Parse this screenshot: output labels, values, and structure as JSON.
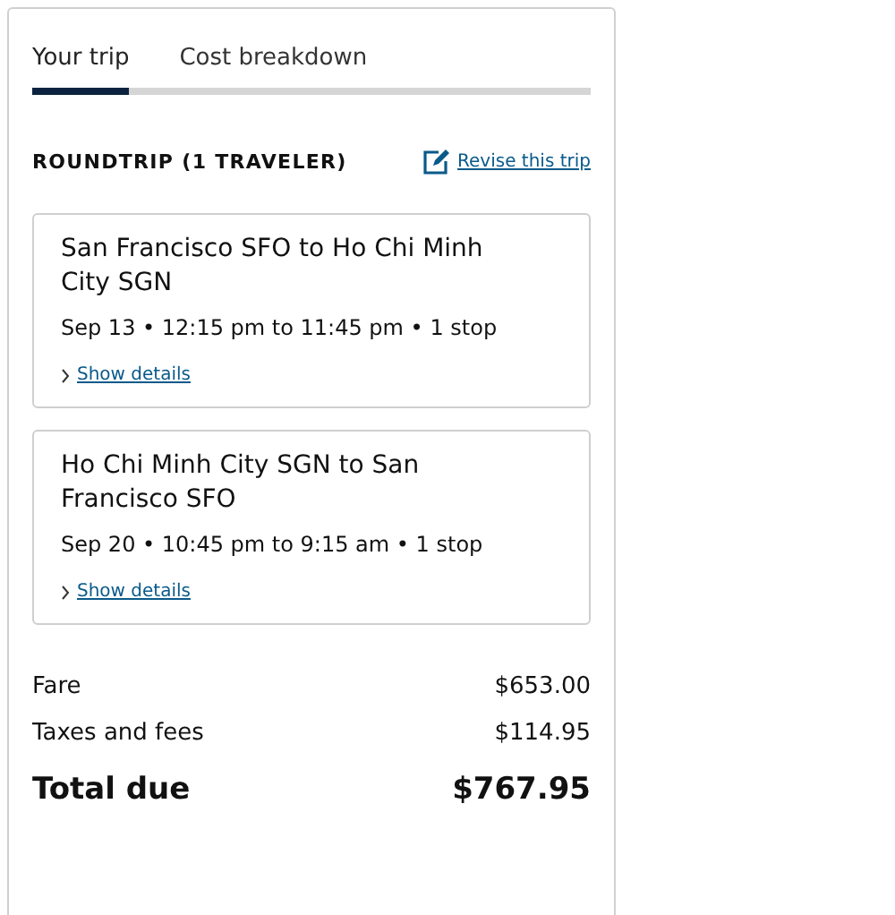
{
  "tabs": [
    {
      "label": "Your trip",
      "selected": true
    },
    {
      "label": "Cost breakdown",
      "selected": false
    }
  ],
  "trip": {
    "heading": "ROUNDTRIP (1 TRAVELER)",
    "revise_link": "Revise this trip"
  },
  "flights": [
    {
      "route": "San Francisco SFO to Ho Chi Minh City SGN",
      "schedule": "Sep 13 • 12:15 pm to 11:45 pm • 1 stop",
      "details_link": "Show details",
      "expanded": false
    },
    {
      "route": "Ho Chi Minh City SGN to San Francisco SFO",
      "schedule": "Sep 20 • 10:45 pm to 9:15 am • 1 stop",
      "details_link": "Show details",
      "expanded": false
    }
  ],
  "costs": [
    {
      "label": "Fare",
      "amount": "$653.00",
      "kind": "line"
    },
    {
      "label": "Taxes and fees",
      "amount": "$114.95",
      "kind": "line"
    },
    {
      "label": "Total due",
      "amount": "$767.95",
      "kind": "total"
    }
  ]
}
